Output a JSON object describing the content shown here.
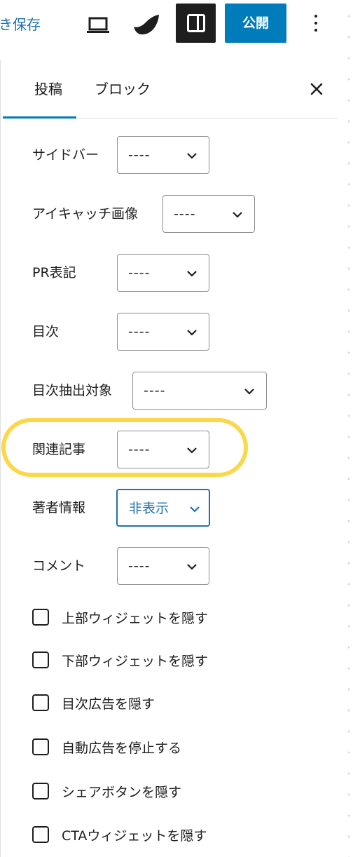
{
  "toolbar": {
    "save_draft": "書き保存",
    "publish": "公開",
    "icons": [
      "laptop-icon",
      "jetpack-icon",
      "settings-sidebar-icon",
      "more-vertical-icon"
    ]
  },
  "tabs": {
    "post": "投稿",
    "block": "ブロック"
  },
  "fields": [
    {
      "label": "サイドバー",
      "value": "----"
    },
    {
      "label": "アイキャッチ画像",
      "value": "----"
    },
    {
      "label": "PR表記",
      "value": "----"
    },
    {
      "label": "目次",
      "value": "----"
    },
    {
      "label": "目次抽出対象",
      "value": "----"
    },
    {
      "label": "関連記事",
      "value": "----"
    },
    {
      "label": "著者情報",
      "value": "非表示"
    },
    {
      "label": "コメント",
      "value": "----"
    }
  ],
  "checkboxes": [
    {
      "label": "上部ウィジェットを隠す",
      "checked": false
    },
    {
      "label": "下部ウィジェットを隠す",
      "checked": false
    },
    {
      "label": "目次広告を隠す",
      "checked": false
    },
    {
      "label": "自動広告を停止する",
      "checked": false
    },
    {
      "label": "シェアボタンを隠す",
      "checked": false
    },
    {
      "label": "CTAウィジェットを隠す",
      "checked": false
    }
  ],
  "colors": {
    "accent": "#007cba",
    "link": "#2271b1",
    "highlight": "#fbd84a",
    "text": "#1e1e1e"
  }
}
